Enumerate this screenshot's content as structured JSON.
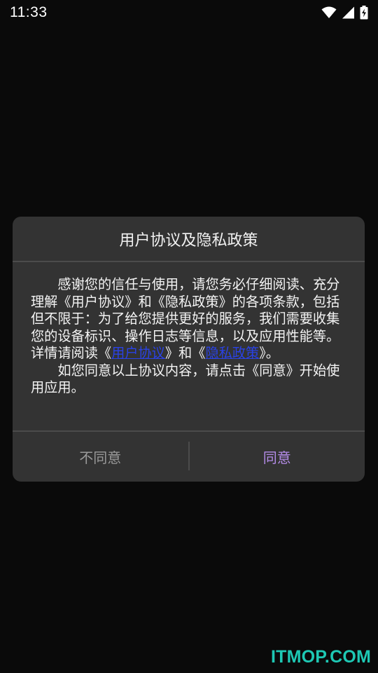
{
  "status_bar": {
    "time": "11:33",
    "icons": [
      "wifi-icon",
      "signal-icon",
      "battery-charging-icon"
    ]
  },
  "dialog": {
    "title": "用户协议及隐私政策",
    "body": {
      "p1_before_link1": "感谢您的信任与使用，请您务必仔细阅读、充分理解《用户协议》和《隐私政策》的各项条款，包括但不限于：为了给您提供更好的服务，我们需要收集您的设备标识、操作日志等信息，以及应用性能等。详情请阅读《",
      "link1": "用户协议",
      "p1_between_links": "》和《",
      "link2": "隐私政策",
      "p1_after_link2": "》。",
      "p2": "如您同意以上协议内容，请点击《同意》开始使用应用。"
    },
    "buttons": {
      "decline": "不同意",
      "agree": "同意"
    },
    "colors": {
      "background": "#333333",
      "link": "#2a42e6",
      "agree": "#b48ce8",
      "decline": "#9a9a9a"
    }
  },
  "watermark": {
    "text": "ITMOP.COM",
    "color": "#1ec8b4"
  }
}
